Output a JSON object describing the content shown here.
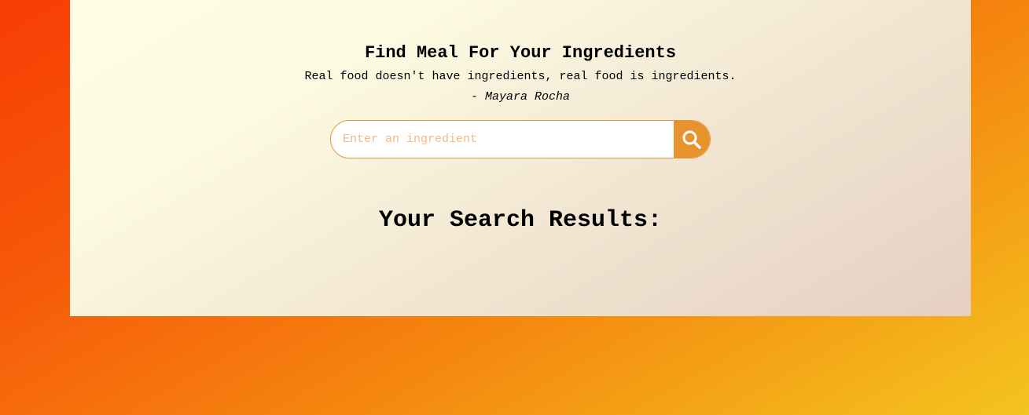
{
  "header": {
    "title": "Find Meal For Your Ingredients",
    "quote": "Real food doesn't have ingredients, real food is ingredients.",
    "author_prefix": "- ",
    "author_name": "Mayara Rocha"
  },
  "search": {
    "placeholder": "Enter an ingredient",
    "value": "",
    "button_icon": "search-icon"
  },
  "results": {
    "heading": "Your Search Results:",
    "items": []
  },
  "colors": {
    "accent": "#e8922e",
    "placeholder": "#f2b983",
    "background_start": "#f73d05",
    "background_end": "#f4c41f"
  }
}
